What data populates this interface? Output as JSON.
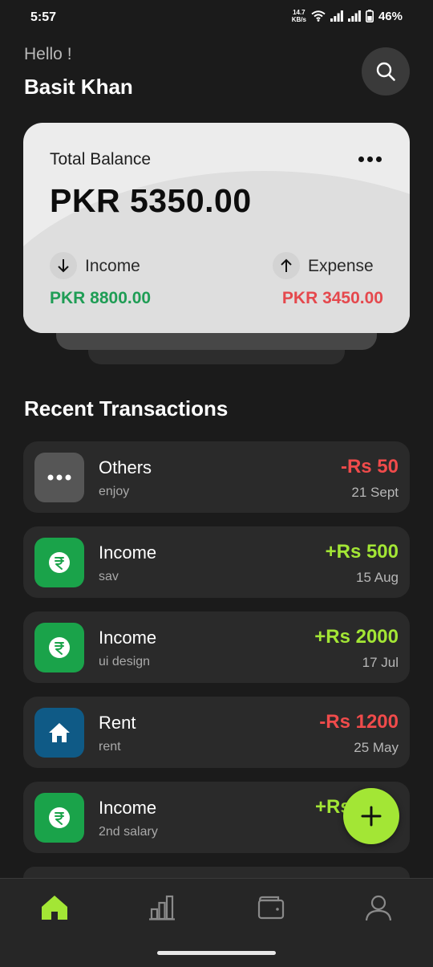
{
  "status_bar": {
    "time": "5:57",
    "net_speed_value": "14.7",
    "net_speed_unit": "KB/s",
    "battery": "46%"
  },
  "header": {
    "greeting": "Hello !",
    "user_name": "Basit Khan",
    "search_icon": "search-icon"
  },
  "balance_card": {
    "label": "Total Balance",
    "amount": "PKR 5350.00",
    "more_icon": "more-horizontal-icon",
    "income": {
      "label": "Income",
      "value": "PKR 8800.00",
      "icon": "arrow-down-icon",
      "color": "#1f9d55"
    },
    "expense": {
      "label": "Expense",
      "value": "PKR 3450.00",
      "icon": "arrow-up-icon",
      "color": "#e5484d"
    }
  },
  "recent_transactions": {
    "title": "Recent Transactions",
    "items": [
      {
        "title": "Others",
        "subtitle": "enjoy",
        "amount": "-Rs 50",
        "date": "21 Sept",
        "icon": "more-horizontal-icon",
        "icon_bg": "#565656",
        "amount_color": "#f04b4b"
      },
      {
        "title": "Income",
        "subtitle": "sav",
        "amount": "+Rs 500",
        "date": "15 Aug",
        "icon": "rupee-icon",
        "icon_bg": "#1aa34a",
        "amount_color": "#a3e635"
      },
      {
        "title": "Income",
        "subtitle": "ui design",
        "amount": "+Rs 2000",
        "date": "17 Jul",
        "icon": "rupee-icon",
        "icon_bg": "#1aa34a",
        "amount_color": "#a3e635"
      },
      {
        "title": "Rent",
        "subtitle": "rent",
        "amount": "-Rs 1200",
        "date": "25 May",
        "icon": "home-icon",
        "icon_bg": "#0f5a86",
        "amount_color": "#f04b4b"
      },
      {
        "title": "Income",
        "subtitle": "2nd salary",
        "amount": "+Rs",
        "date": "",
        "icon": "rupee-icon",
        "icon_bg": "#1aa34a",
        "amount_color": "#a3e635"
      }
    ]
  },
  "fab": {
    "icon": "plus-icon",
    "color": "#a3e635"
  },
  "bottom_nav": {
    "items": [
      {
        "name": "home",
        "icon": "home-icon",
        "active": true
      },
      {
        "name": "stats",
        "icon": "bar-chart-icon",
        "active": false
      },
      {
        "name": "wallet",
        "icon": "wallet-icon",
        "active": false
      },
      {
        "name": "profile",
        "icon": "user-icon",
        "active": false
      }
    ],
    "active_color": "#a3e635"
  }
}
